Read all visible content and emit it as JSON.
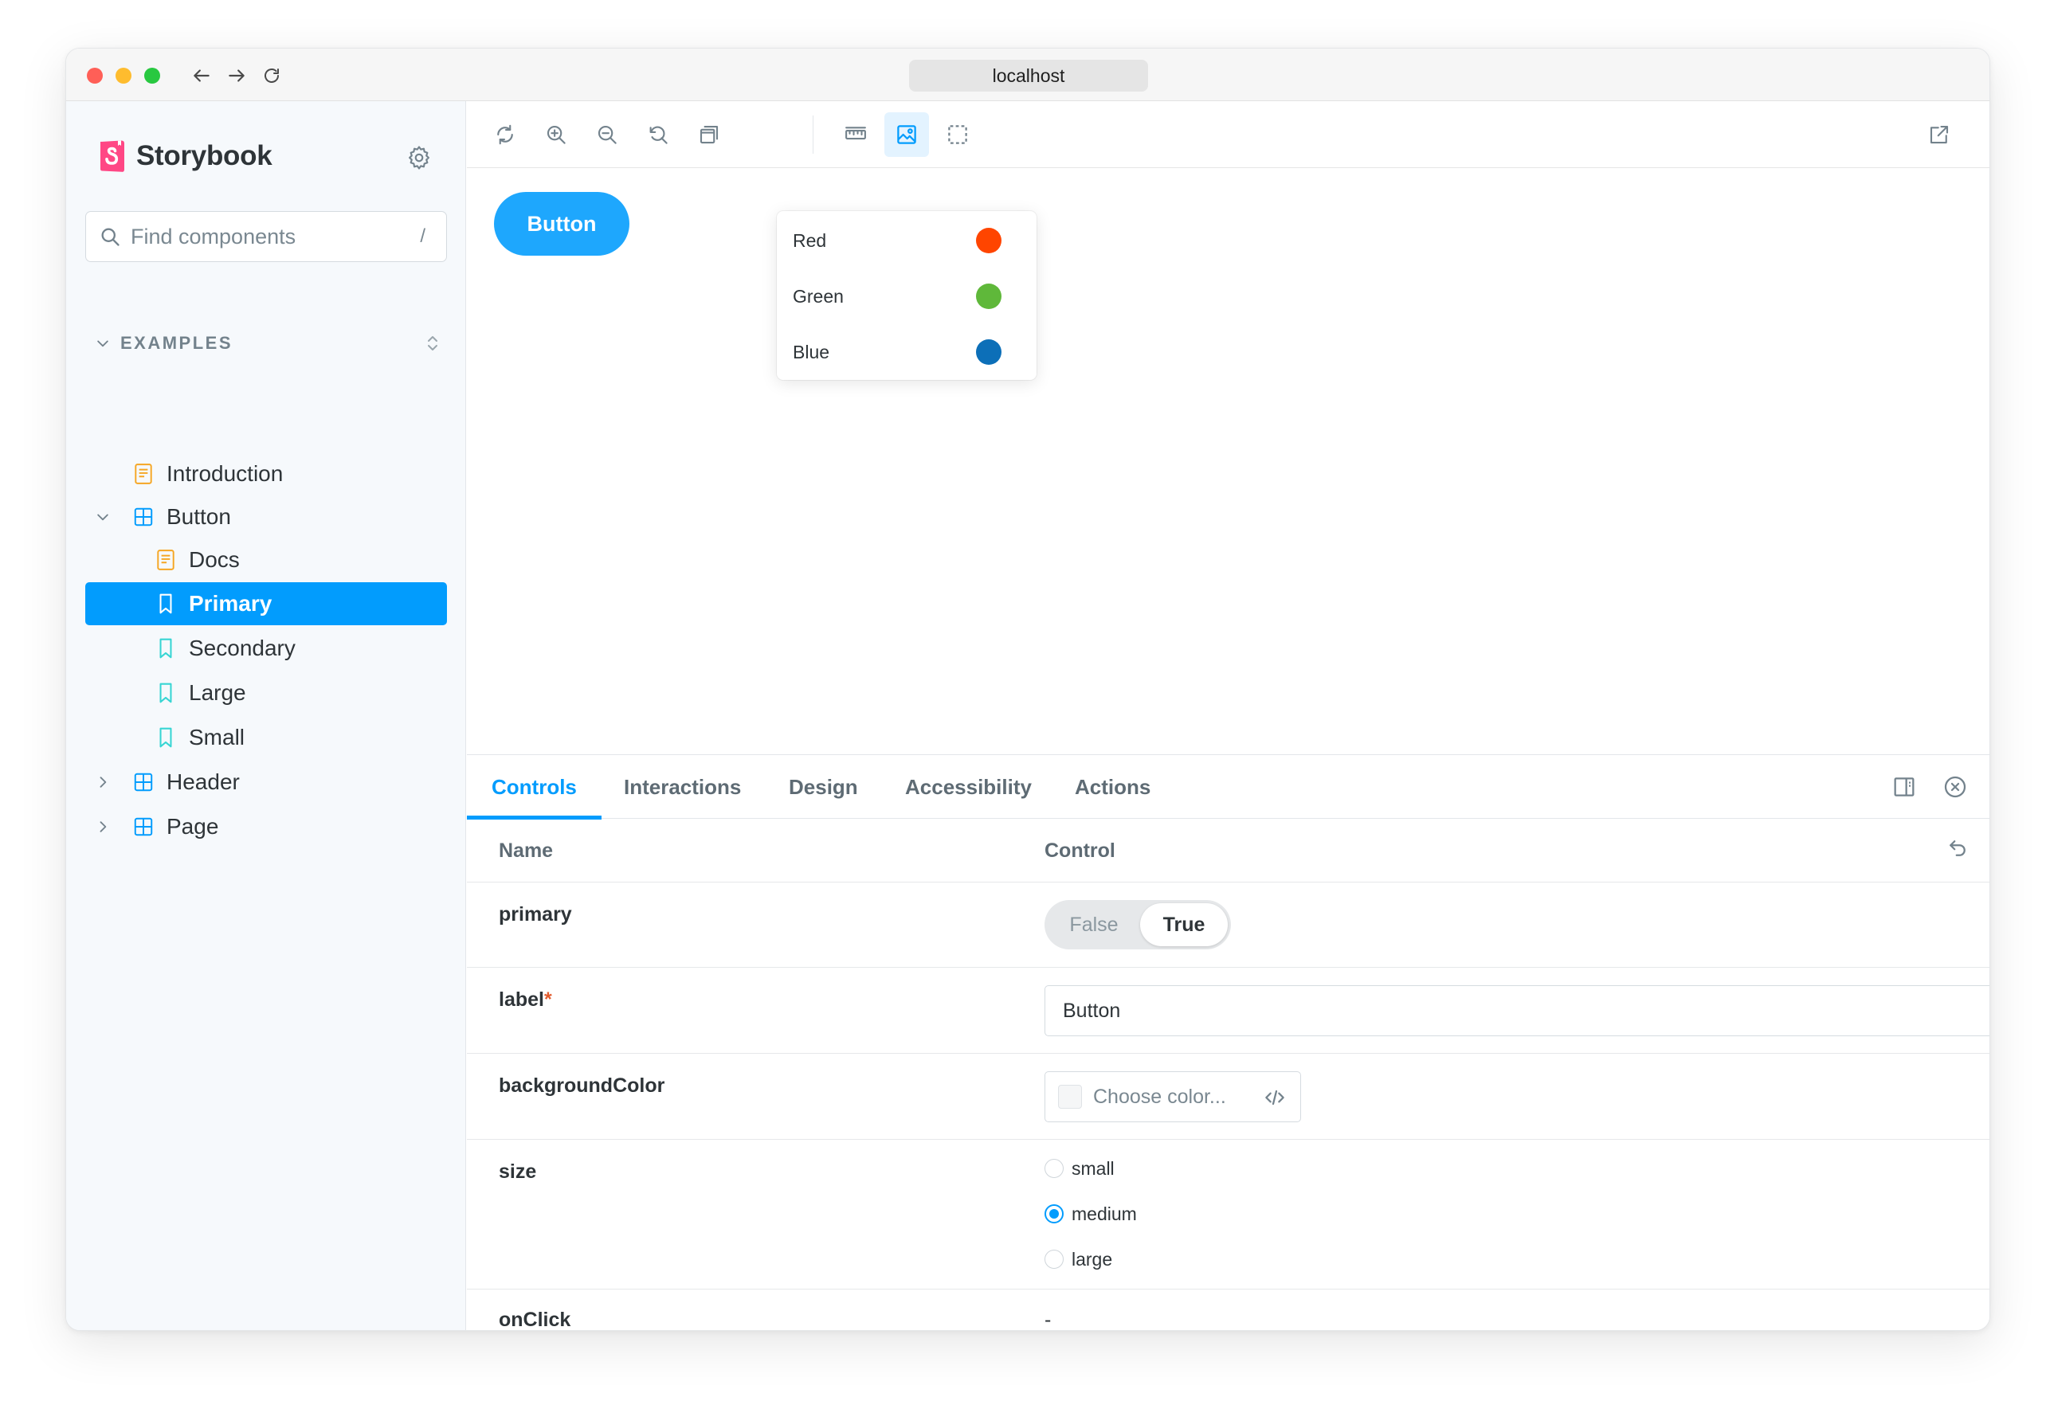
{
  "browser": {
    "url": "localhost",
    "traffic_lights": {
      "close": "#ff5f57",
      "minimize": "#febc2e",
      "zoom": "#28c840"
    }
  },
  "sidebar": {
    "brand": "Storybook",
    "search": {
      "placeholder": "Find components",
      "shortcut": "/"
    },
    "section": "EXAMPLES",
    "items": [
      {
        "label": "Introduction",
        "type": "docs"
      },
      {
        "label": "Button",
        "type": "component",
        "expanded": true
      },
      {
        "label": "Docs",
        "type": "docs"
      },
      {
        "label": "Primary",
        "type": "story",
        "selected": true
      },
      {
        "label": "Secondary",
        "type": "story"
      },
      {
        "label": "Large",
        "type": "story"
      },
      {
        "label": "Small",
        "type": "story"
      },
      {
        "label": "Header",
        "type": "component",
        "expanded": false
      },
      {
        "label": "Page",
        "type": "component",
        "expanded": false
      }
    ]
  },
  "toolbar": {
    "tools": [
      "remount-icon",
      "zoom-in-icon",
      "zoom-out-icon",
      "zoom-reset-icon",
      "viewport-icon",
      "measure-icon",
      "background-icon",
      "outline-icon"
    ],
    "active_tool": "background-icon",
    "external": "open-new-tab-icon"
  },
  "preview": {
    "button_label": "Button",
    "button_color": "#1ea7fd"
  },
  "background_menu": {
    "options": [
      {
        "label": "Red",
        "color": "#ff4500"
      },
      {
        "label": "Green",
        "color": "#5fb83a"
      },
      {
        "label": "Blue",
        "color": "#0c6fb8"
      }
    ]
  },
  "panel": {
    "tabs": [
      "Controls",
      "Interactions",
      "Design",
      "Accessibility",
      "Actions"
    ],
    "active_tab": "Controls",
    "table": {
      "headers": {
        "name": "Name",
        "control": "Control"
      },
      "rows": {
        "primary": {
          "name": "primary",
          "false_label": "False",
          "true_label": "True",
          "value": "True"
        },
        "label": {
          "name": "label",
          "required": "*",
          "value": "Button"
        },
        "backgroundColor": {
          "name": "backgroundColor",
          "placeholder": "Choose color..."
        },
        "size": {
          "name": "size",
          "options": [
            "small",
            "medium",
            "large"
          ],
          "selected": "medium"
        },
        "onClick": {
          "name": "onClick",
          "value": "-"
        }
      }
    }
  },
  "accent_color": "#029cfd"
}
